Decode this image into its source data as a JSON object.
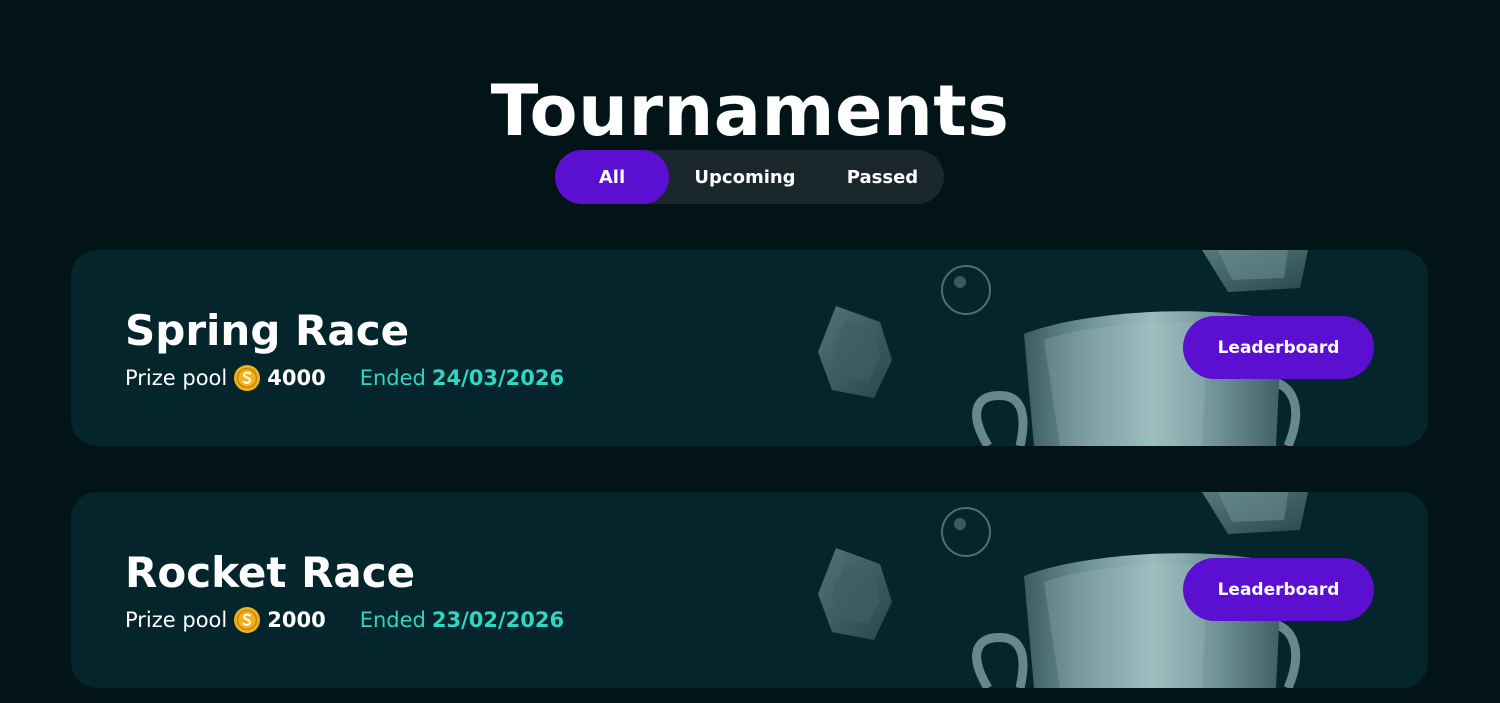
{
  "page": {
    "title": "Tournaments"
  },
  "tabs": [
    {
      "label": "All",
      "active": true
    },
    {
      "label": "Upcoming",
      "active": false
    },
    {
      "label": "Passed",
      "active": false
    }
  ],
  "tournaments": [
    {
      "name": "Spring Race",
      "prize_label": "Prize pool",
      "prize_value": "4000",
      "status_label": "Ended",
      "date": "24/03/2026",
      "button_label": "Leaderboard"
    },
    {
      "name": "Rocket Race",
      "prize_label": "Prize pool",
      "prize_value": "2000",
      "status_label": "Ended",
      "date": "23/02/2026",
      "button_label": "Leaderboard"
    }
  ],
  "colors": {
    "background": "#031418",
    "card": "#04252b",
    "accent_purple": "#5b0fd0",
    "accent_teal": "#2fd6c4",
    "coin": "#f2b21b"
  },
  "icons": {
    "coin": "coin-icon",
    "trophy_art": "trophy-cup-art"
  }
}
